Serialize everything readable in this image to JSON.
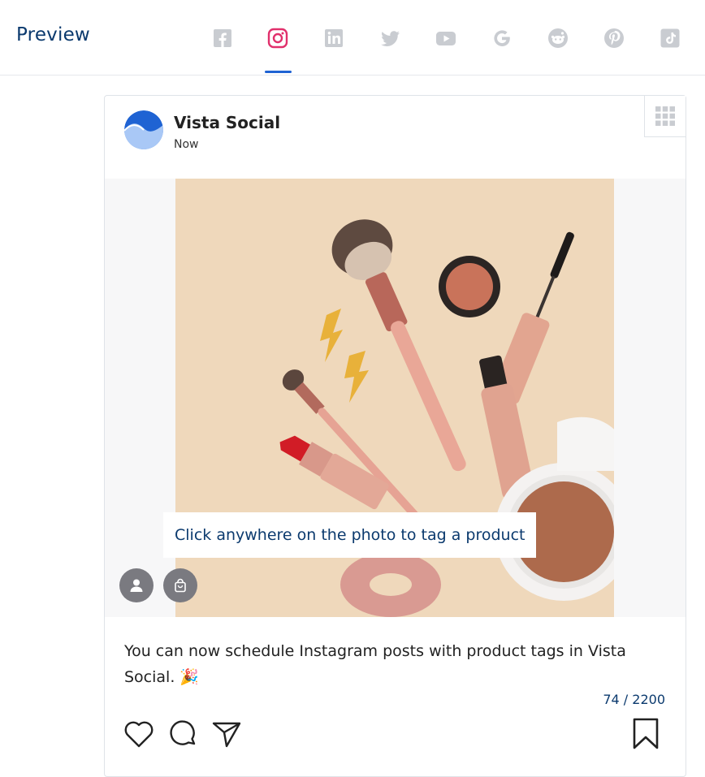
{
  "header": {
    "title": "Preview",
    "tabs": [
      {
        "name": "facebook",
        "icon": "facebook-icon"
      },
      {
        "name": "instagram",
        "icon": "instagram-icon",
        "active": true
      },
      {
        "name": "linkedin",
        "icon": "linkedin-icon"
      },
      {
        "name": "twitter",
        "icon": "twitter-icon"
      },
      {
        "name": "youtube",
        "icon": "youtube-icon"
      },
      {
        "name": "google",
        "icon": "google-icon"
      },
      {
        "name": "reddit",
        "icon": "reddit-icon"
      },
      {
        "name": "pinterest",
        "icon": "pinterest-icon"
      },
      {
        "name": "tiktok",
        "icon": "tiktok-icon"
      }
    ],
    "active_color": "#1f63d3"
  },
  "post": {
    "account_name": "Vista Social",
    "time": "Now",
    "tag_hint": "Click anywhere on the photo to tag a product",
    "caption": "You can now schedule Instagram posts with product tags in Vista Social. 🎉",
    "char_count": "74 / 2200"
  },
  "colors": {
    "brand_dark": "#0b3a6e",
    "instagram_pink": "#e1306c",
    "inactive_icon": "#c9ccd1"
  }
}
